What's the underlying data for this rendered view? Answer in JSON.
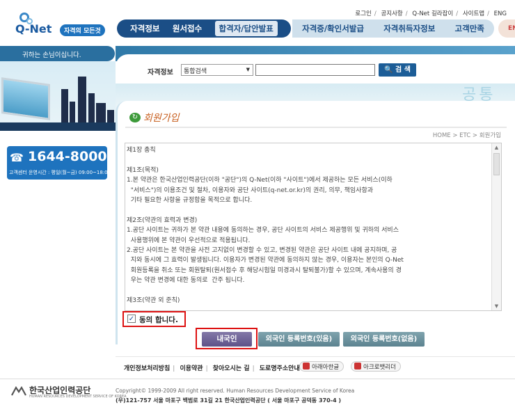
{
  "header": {
    "util_links": [
      "로그인",
      "공지사항",
      "Q-Net 길라잡이",
      "사이트맵",
      "ENG"
    ],
    "logo_text": "Q-Net",
    "logo_badge": "자격의 모든것",
    "main_nav": [
      "자격정보",
      "원서접수",
      "합격자/답안발표"
    ],
    "main_nav_active": "합격자/답안발표",
    "sub_nav": [
      "자격증/확인서발급",
      "자격취득자정보",
      "고객만족"
    ],
    "eng_tab": "EN"
  },
  "sidebar": {
    "welcome": "귀하는 손님이십니다.",
    "phone": "1644-8000",
    "phone_hours": "고객센터 운영시간 : 평일(월~금) 09:00~18:00"
  },
  "search": {
    "label": "자격정보",
    "select_value": "통합검색",
    "input_value": "",
    "button_label": "검 색"
  },
  "section_watermark": "공통",
  "page": {
    "title": "회원가입",
    "breadcrumb": "HOME > ETC > 회원가입",
    "terms_text": "제1장 총칙\n\n제1조(목적)\n1.본 약관은 한국산업인력공단(이하 \"공단\")의 Q-Net(이하 \"사이트\")에서 제공하는 모든 서비스(이하\n  \"서비스\")의 이용조건 및 절차, 이용자와 공단 사이트(q-net.or.kr)의 권리, 의무, 책임사항과\n  기타 필요한 사항을 규정함을 목적으로 합니다.\n\n제2조(약관의 효력과 변경)\n1.공단 사이트는 귀하가 본 약관 내용에 동의하는 경우, 공단 사이트의 서비스 제공행위 및 귀하의 서비스\n  사용행위에 본 약관이 우선적으로 적용됩니다.\n2.공단 사이트는 본 약관을 사전 고지없이 변경할 수 있고, 변경된 약관은 공단 사이트 내에 공지하며, 공\n  지와 동시에 그 효력이 발생됩니다. 이용자가 변경된 약관에 동의하지 않는 경우, 이용자는 본인의 Q-Net\n  회원등록을 취소 또는 회원탈퇴(원서접수 후 해당시험일 미경과시 탈퇴불가)할 수 있으며, 계속사용의 경\n  우는 약관 변경에 대한 동의로  간주 됩니다.\n\n제3조(약관 외 준칙)",
    "agree_checked": true,
    "agree_label": "동의 합니다.",
    "buttons": {
      "domestic": "내국인",
      "foreign_yes": "외국인 등록번호(있음)",
      "foreign_no": "외국인 등록번호(없음)"
    }
  },
  "footer": {
    "links": [
      "개인정보처리방침",
      "이용약관",
      "찾아오시는 길",
      "도로명주소안내"
    ],
    "downloads": [
      "아래아한글",
      "아크로뱃리더"
    ],
    "org_name": "한국산업인력공단",
    "org_eng": "HUMAN RESOURCES DEVELOPMENT SERVICE OF KOREA",
    "copyright": "Copyright© 1999-2009 All right reserved. Human Resources Development Service of Korea",
    "address": "(우)121-757 서울 마포구 백범로 31길 21 한국산업인력공단 ( 서울 마포구 공덕동 370-4 )"
  }
}
